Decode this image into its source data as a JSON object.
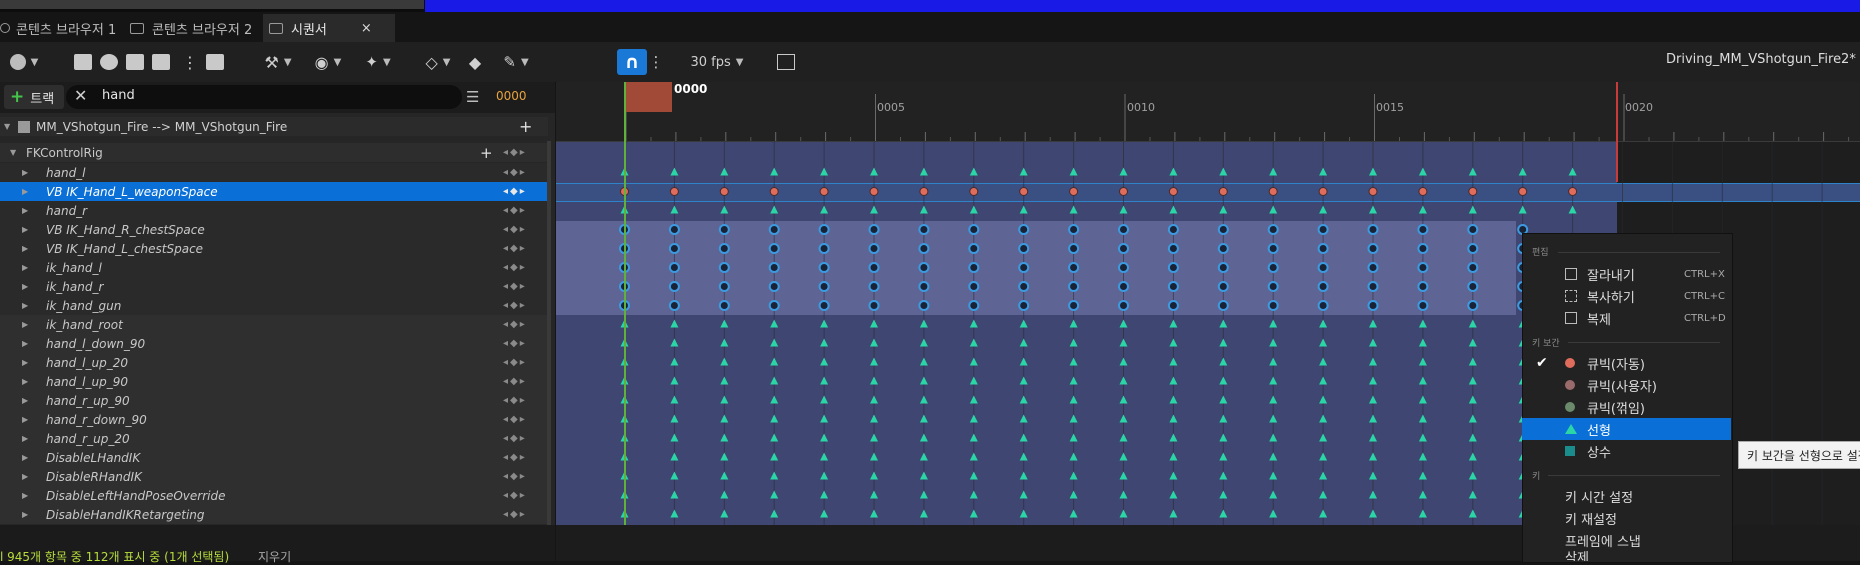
{
  "tabs": [
    {
      "label": "콘텐츠 브라우저 1"
    },
    {
      "label": "콘텐츠 브라우저 2"
    },
    {
      "label": "시퀀서",
      "close": "×"
    }
  ],
  "toolbar": {
    "fps": "30 fps",
    "asset_title": "Driving_MM_VShotgun_Fire2*"
  },
  "filter": {
    "add_track": "트랙",
    "search_value": "hand",
    "frame": "0000"
  },
  "outliner": {
    "root": "MM_VShotgun_Fire --> MM_VShotgun_Fire",
    "group": "FKControlRig",
    "tracks": [
      {
        "label": "hand_l"
      },
      {
        "label": "VB IK_Hand_L_weaponSpace",
        "selected": true
      },
      {
        "label": "hand_r"
      },
      {
        "label": "VB IK_Hand_R_chestSpace"
      },
      {
        "label": "VB IK_Hand_L_chestSpace"
      },
      {
        "label": "ik_hand_l"
      },
      {
        "label": "ik_hand_r"
      },
      {
        "label": "ik_hand_gun"
      },
      {
        "label": "ik_hand_root"
      },
      {
        "label": "hand_l_down_90"
      },
      {
        "label": "hand_l_up_20"
      },
      {
        "label": "hand_l_up_90"
      },
      {
        "label": "hand_r_up_90"
      },
      {
        "label": "hand_r_down_90"
      },
      {
        "label": "hand_r_up_20"
      },
      {
        "label": "DisableLHandIK"
      },
      {
        "label": "DisableRHandIK"
      },
      {
        "label": "DisableLeftHandPoseOverride"
      },
      {
        "label": "DisableHandIKRetargeting"
      }
    ]
  },
  "status": {
    "text": "l 945개 항목 중 112개 표시 중 (1개 선택됨)",
    "clear": "지우기"
  },
  "timeline": {
    "playhead": "0000",
    "ruler_labels": [
      "0005",
      "0010",
      "0015",
      "0020"
    ]
  },
  "context_menu": {
    "section_edit": "편집",
    "cut": "잘라내기",
    "cut_sc": "CTRL+X",
    "copy": "복사하기",
    "copy_sc": "CTRL+C",
    "dup": "복제",
    "dup_sc": "CTRL+D",
    "section_interp": "키 보간",
    "cubic_auto": "큐빅(자동)",
    "cubic_user": "큐빅(사용자)",
    "cubic_break": "큐빅(꺾임)",
    "linear": "선형",
    "constant": "상수",
    "section_key": "키",
    "set_key_time": "키 시간 설정",
    "rekey": "키 재설정",
    "snap_frames": "프레임에 스냅",
    "delete": "삭제"
  },
  "tooltip": "키 보간을 선형으로 설정",
  "colors": {
    "accent": "#0a70d8",
    "cubic_auto": "#e06c5c",
    "cubic_user": "#d08080",
    "cubic_break": "#7fa87f",
    "linear": "#2bd6a6",
    "constant": "#1a8c8c",
    "key_circle": "#3c9be0"
  }
}
